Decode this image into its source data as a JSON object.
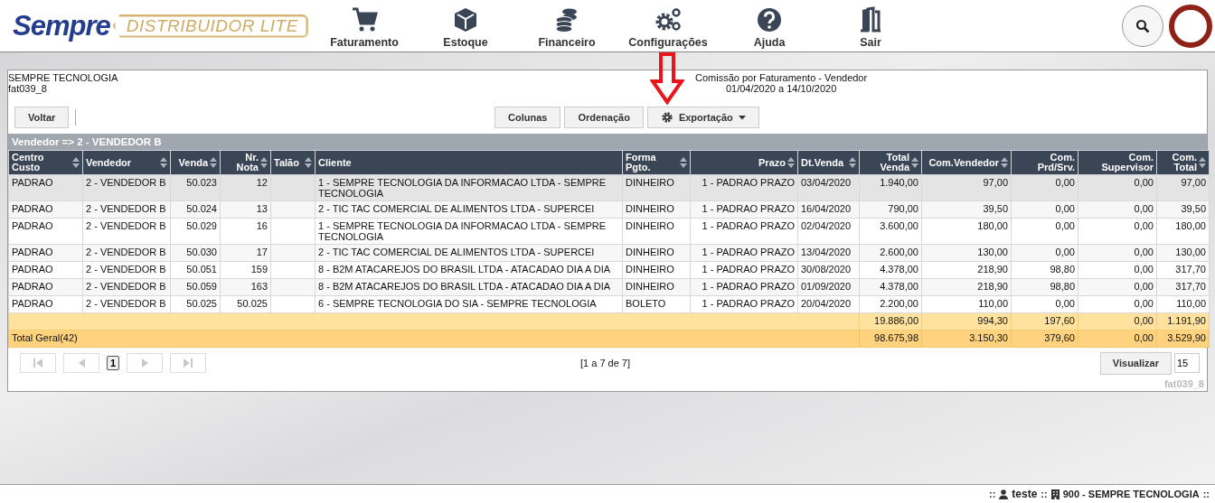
{
  "header": {
    "logo": {
      "brand": "Sempre",
      "product": "DISTRIBUIDOR LITE"
    },
    "nav": [
      {
        "label": "Faturamento"
      },
      {
        "label": "Estoque"
      },
      {
        "label": "Financeiro"
      },
      {
        "label": "Configurações"
      },
      {
        "label": "Ajuda"
      },
      {
        "label": "Sair"
      }
    ]
  },
  "report": {
    "company": "SEMPRE TECNOLOGIA",
    "code": "fat039_8",
    "title": "Comissão por Faturamento - Vendedor",
    "period": "01/04/2020 a 14/10/2020",
    "back_button": "Voltar",
    "toolbar": [
      {
        "label": "Colunas",
        "kind": "plain"
      },
      {
        "label": "Ordenação",
        "kind": "plain"
      },
      {
        "label": "Exportação",
        "kind": "dropdown"
      }
    ],
    "group_header": "Vendedor => 2 - VENDEDOR B",
    "table": {
      "columns": [
        {
          "label": "Centro Custo",
          "sortable": true
        },
        {
          "label": "Vendedor",
          "sortable": true
        },
        {
          "label": "Venda",
          "sortable": true
        },
        {
          "label": "Nr. Nota",
          "sortable": true
        },
        {
          "label": "Talão",
          "sortable": true
        },
        {
          "label": "Cliente",
          "sortable": false
        },
        {
          "label": "Forma Pgto.",
          "sortable": true
        },
        {
          "label": "Prazo",
          "sortable": true
        },
        {
          "label": "Dt.Venda",
          "sortable": true
        },
        {
          "label": "Total Venda",
          "sortable": true
        },
        {
          "label": "Com.Vendedor",
          "sortable": true
        },
        {
          "label": "Com. Prd/Srv.",
          "sortable": false
        },
        {
          "label": "Com. Supervisor",
          "sortable": false
        },
        {
          "label": "Com. Total",
          "sortable": true
        }
      ],
      "rows": [
        {
          "highlighted": true,
          "cells": [
            "PADRAO",
            "2 - VENDEDOR B",
            "50.023",
            "12",
            "",
            "1 - SEMPRE TECNOLOGIA DA INFORMACAO LTDA - SEMPRE TECNOLOGIA",
            "DINHEIRO",
            "1 - PADRAO PRAZO",
            "03/04/2020",
            "1.940,00",
            "97,00",
            "0,00",
            "0,00",
            "97,00"
          ]
        },
        {
          "highlighted": false,
          "cells": [
            "PADRAO",
            "2 - VENDEDOR B",
            "50.024",
            "13",
            "",
            "2 - TIC TAC COMERCIAL DE ALIMENTOS LTDA - SUPERCEI",
            "DINHEIRO",
            "1 - PADRAO PRAZO",
            "16/04/2020",
            "790,00",
            "39,50",
            "0,00",
            "0,00",
            "39,50"
          ]
        },
        {
          "highlighted": false,
          "cells": [
            "PADRAO",
            "2 - VENDEDOR B",
            "50.029",
            "16",
            "",
            "1 - SEMPRE TECNOLOGIA DA INFORMACAO LTDA - SEMPRE TECNOLOGIA",
            "DINHEIRO",
            "1 - PADRAO PRAZO",
            "02/04/2020",
            "3.600,00",
            "180,00",
            "0,00",
            "0,00",
            "180,00"
          ]
        },
        {
          "highlighted": false,
          "cells": [
            "PADRAO",
            "2 - VENDEDOR B",
            "50.030",
            "17",
            "",
            "2 - TIC TAC COMERCIAL DE ALIMENTOS LTDA - SUPERCEI",
            "DINHEIRO",
            "1 - PADRAO PRAZO",
            "13/04/2020",
            "2.600,00",
            "130,00",
            "0,00",
            "0,00",
            "130,00"
          ]
        },
        {
          "highlighted": false,
          "cells": [
            "PADRAO",
            "2 - VENDEDOR B",
            "50.051",
            "159",
            "",
            "8 - B2M ATACAREJOS DO BRASIL LTDA - ATACADAO DIA A DIA",
            "DINHEIRO",
            "1 - PADRAO PRAZO",
            "30/08/2020",
            "4.378,00",
            "218,90",
            "98,80",
            "0,00",
            "317,70"
          ]
        },
        {
          "highlighted": false,
          "cells": [
            "PADRAO",
            "2 - VENDEDOR B",
            "50.059",
            "163",
            "",
            "8 - B2M ATACAREJOS DO BRASIL LTDA - ATACADAO DIA A DIA",
            "DINHEIRO",
            "1 - PADRAO PRAZO",
            "01/09/2020",
            "4.378,00",
            "218,90",
            "98,80",
            "0,00",
            "317,70"
          ]
        },
        {
          "highlighted": false,
          "cells": [
            "PADRAO",
            "2 - VENDEDOR B",
            "50.025",
            "50.025",
            "",
            "6 - SEMPRE TECNOLOGIA DO SIA - SEMPRE TECNOLOGIA",
            "BOLETO",
            "1 - PADRAO PRAZO",
            "20/04/2020",
            "2.200,00",
            "110,00",
            "0,00",
            "0,00",
            "110,00"
          ]
        }
      ],
      "subtotal": {
        "values": [
          "19.886,00",
          "994,30",
          "197,60",
          "0,00",
          "1.191,90"
        ]
      },
      "total": {
        "label": "Total Geral(42)",
        "values": [
          "98.675,98",
          "3.150,30",
          "379,60",
          "0,00",
          "3.529,90"
        ]
      }
    },
    "pagination": {
      "buttons": [
        {
          "kind": "first",
          "disabled": true
        },
        {
          "kind": "prev",
          "disabled": true
        },
        {
          "kind": "page",
          "label": "1",
          "selected": true
        },
        {
          "kind": "next",
          "disabled": true
        },
        {
          "kind": "last",
          "disabled": true
        }
      ],
      "info": "[1 a 7 de 7]",
      "view_button": "Visualizar",
      "page_size": "15"
    },
    "footer_code": "fat039_8"
  },
  "status_bar": {
    "user": "teste",
    "company": "900 - SEMPRE TECNOLOGIA",
    "separator": "::"
  }
}
